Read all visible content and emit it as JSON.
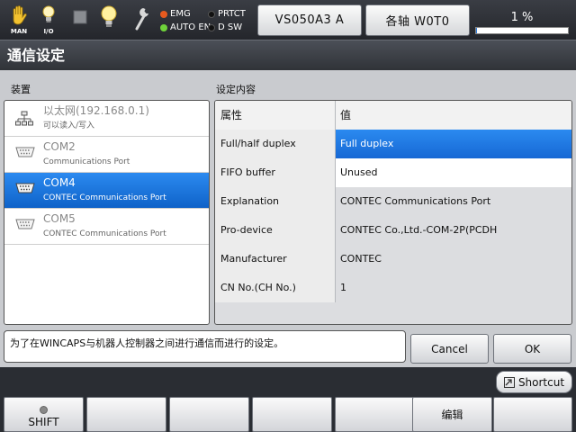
{
  "status_bar": {
    "mode_label": "MAN",
    "io_label": "I/O",
    "indicators": [
      {
        "label": "EMG",
        "color": "#e65a1f"
      },
      {
        "label": "PRTCT",
        "color": "#111111"
      },
      {
        "label": "AUTO EN",
        "color": "#6fd23a"
      },
      {
        "label": "D SW",
        "color": "#111111"
      }
    ],
    "robot_button": "VS050A3 A",
    "axis_button": "各轴 W0T0",
    "progress_label": "1 %",
    "progress_percent": 1
  },
  "title": "通信设定",
  "devices": {
    "label": "装置",
    "items": [
      {
        "name": "以太网(192.168.0.1)",
        "sub": "可以读入/写入",
        "icon": "network-icon",
        "selected": false
      },
      {
        "name": "COM2",
        "sub": "Communications Port",
        "icon": "serial-port-icon",
        "selected": false
      },
      {
        "name": "COM4",
        "sub": "CONTEC Communications Port",
        "icon": "serial-port-icon",
        "selected": true
      },
      {
        "name": "COM5",
        "sub": "CONTEC Communications Port",
        "icon": "serial-port-icon",
        "selected": false
      }
    ]
  },
  "settings": {
    "label": "设定内容",
    "header": {
      "property": "属性",
      "value": "值"
    },
    "rows": [
      {
        "property": "Full/half duplex",
        "value": "Full duplex"
      },
      {
        "property": "FIFO buffer",
        "value": "Unused"
      },
      {
        "property": "Explanation",
        "value": "CONTEC Communications Port"
      },
      {
        "property": "Pro-device",
        "value": "CONTEC Co.,Ltd.-COM-2P(PCDH"
      },
      {
        "property": "Manufacturer",
        "value": "CONTEC"
      },
      {
        "property": "CN No.(CH No.)",
        "value": "1"
      }
    ]
  },
  "description": "为了在WINCAPS与机器人控制器之间进行通信而进行的设定。",
  "buttons": {
    "cancel": "Cancel",
    "ok": "OK",
    "shortcut": "Shortcut"
  },
  "function_keys": [
    "SHIFT",
    "",
    "",
    "",
    "",
    "编辑",
    ""
  ]
}
